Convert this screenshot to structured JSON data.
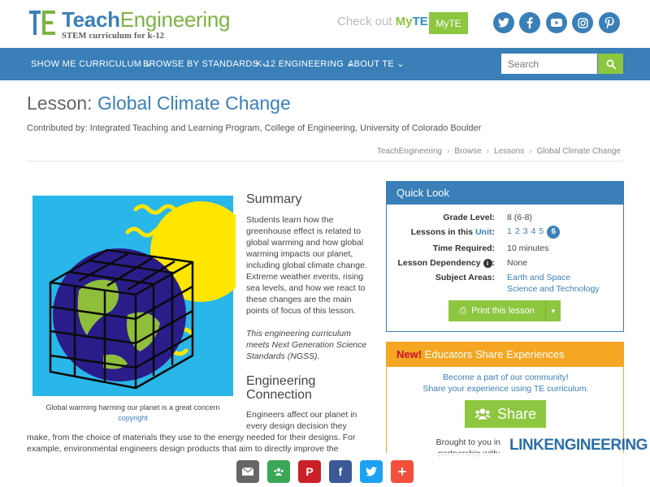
{
  "header": {
    "logo_title_1": "Teach",
    "logo_title_2": "Engineering",
    "logo_sub": "STEM curriculum for k-12",
    "myte_prefix": "Check out ",
    "myte_my": "My",
    "myte_te": "TE",
    "myte_button": "MyTE",
    "social": [
      "twitter-icon",
      "facebook-icon",
      "youtube-icon",
      "instagram-icon",
      "pinterest-icon"
    ]
  },
  "nav": {
    "items": [
      "SHOW ME CURRICULUM",
      "BROWSE BY STANDARDS",
      "K-12 ENGINEERING",
      "ABOUT TE"
    ],
    "search_placeholder": "Search"
  },
  "page": {
    "title_prefix": "Lesson:",
    "title": "Global Climate Change",
    "contributed": "Contributed by: Integrated Teaching and Learning Program, College of Engineering, University of Colorado Boulder",
    "breadcrumb": [
      "TeachEngineering",
      "Browse",
      "Lessons",
      "Global Climate Change"
    ]
  },
  "image": {
    "caption": "Global warming harming our planet is a great concern",
    "credit": "copyright"
  },
  "summary": {
    "heading": "Summary",
    "text": "Students learn how the greenhouse effect is related to global warming and how global warming impacts our planet, including global climate change. Extreme weather events, rising sea levels, and how we react to these changes are the main points of focus of this lesson.",
    "ngss": "This engineering curriculum meets Next Generation Science Standards (NGSS)."
  },
  "engineering": {
    "heading_1": "Engineering",
    "heading_2": "Connection",
    "text_narrow": "Engineers affect our planet in every design decision they",
    "text_wide": "make, from the choice of materials they use to the energy needed for their designs. For example, environmental engineers design products that aim to directly improve the"
  },
  "quick_look": {
    "heading": "Quick Look",
    "grade_label": "Grade Level:",
    "grade_value": "8 (6-8)",
    "lessons_label_prefix": "Lessons in this ",
    "lessons_label_link": "Unit",
    "lessons_label_suffix": ":",
    "lessons": [
      "1",
      "2",
      "3",
      "4",
      "5"
    ],
    "current_lesson": "6",
    "time_label": "Time Required:",
    "time_value": "10 minutes",
    "dependency_label": "Lesson Dependency",
    "dependency_value": "None",
    "subject_label": "Subject Areas:",
    "subjects": [
      "Earth and Space",
      "Science and Technology"
    ],
    "print_label": "Print this lesson"
  },
  "educators": {
    "new_label": "New!",
    "heading": " Educators Share Experiences",
    "line1": "Become a part of our community!",
    "line2": "Share your experience using TE curriculum.",
    "share_label": "Share",
    "brought_1": "Brought to you in",
    "brought_2": "partnership with:",
    "partner_1": "LINK",
    "partner_2": "ENGINEERING"
  },
  "sharebar": {
    "buttons": [
      {
        "name": "email-icon",
        "color": "#666666"
      },
      {
        "name": "classroom-icon",
        "color": "#3aa757"
      },
      {
        "name": "pinterest-icon",
        "color": "#cb2027"
      },
      {
        "name": "facebook-icon",
        "color": "#3b5998"
      },
      {
        "name": "twitter-icon",
        "color": "#1da1f2"
      },
      {
        "name": "more-icon",
        "color": "#f0503c"
      }
    ]
  },
  "colors": {
    "brand_blue": "#3a7fb8",
    "brand_green": "#8dc63f",
    "accent_orange": "#f5a623"
  }
}
